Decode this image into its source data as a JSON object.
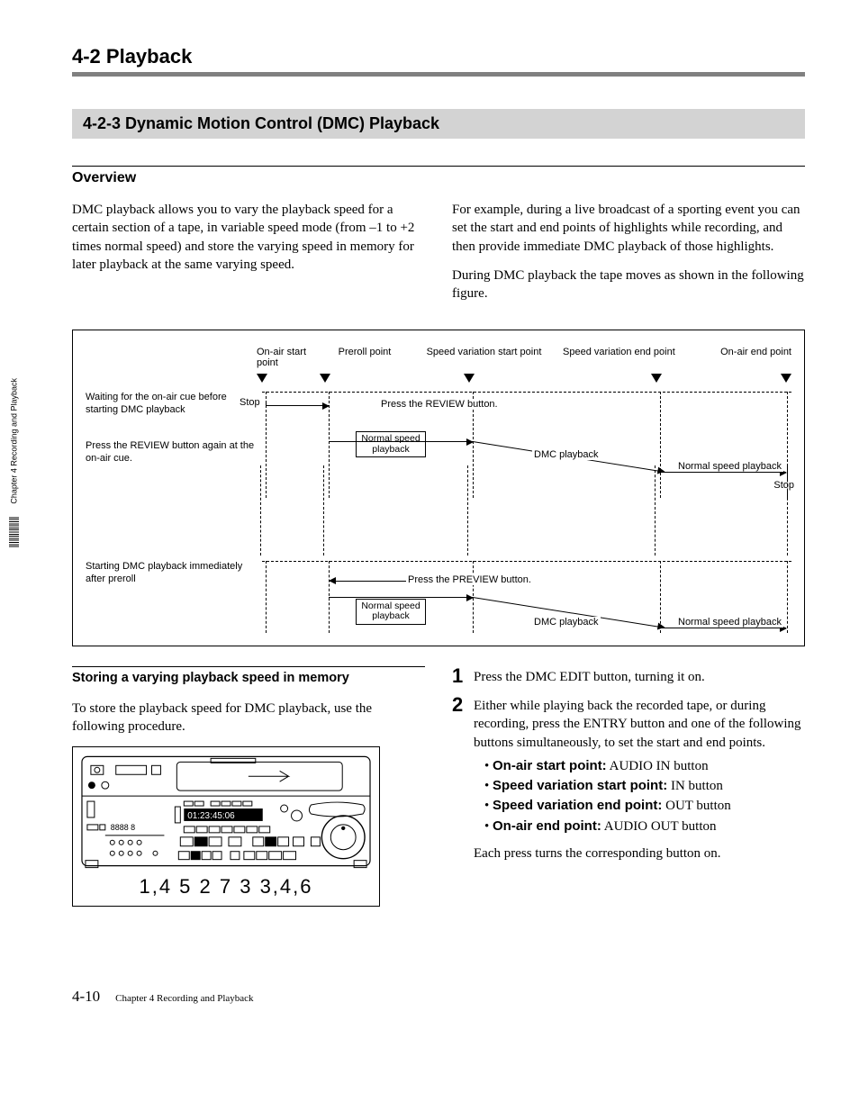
{
  "chapterTab": "Chapter 4   Recording and Playback",
  "header": {
    "chapterTitle": "4-2  Playback",
    "sectionTitle": "4-2-3  Dynamic Motion Control (DMC) Playback"
  },
  "overview": {
    "heading": "Overview",
    "paraLeft": "DMC playback allows you to vary the playback speed for a certain section of a tape, in variable speed mode (from –1 to +2 times normal speed) and store the varying speed in memory for later playback at the same varying speed.",
    "paraRight1": "For example, during a live broadcast of a sporting event you can set the start and end points of highlights while recording, and then provide immediate DMC playback of those highlights.",
    "paraRight2": "During DMC playback the tape moves as shown in the following figure."
  },
  "diagram": {
    "topLabels": {
      "onAirStart": "On-air start point",
      "preroll": "Preroll point",
      "speedStart": "Speed variation start point",
      "speedEnd": "Speed variation end point",
      "onAirEnd": "On-air end point"
    },
    "section1": {
      "leftText": "Waiting for the on-air cue before starting DMC playback",
      "stop": "Stop",
      "reviewBtn": "Press the REVIEW button.",
      "leftText2": "Press the REVIEW button again at the on-air cue.",
      "normal": "Normal speed playback",
      "dmc": "DMC playback",
      "normal2": "Normal speed playback",
      "stop2": "Stop"
    },
    "section2": {
      "leftText": "Starting DMC playback immediately after preroll",
      "previewBtn": "Press the PREVIEW button.",
      "normal": "Normal speed playback",
      "dmc": "DMC playback",
      "normal2": "Normal speed playback"
    }
  },
  "storing": {
    "heading": "Storing a varying playback speed in memory",
    "para": "To store the playback speed for DMC playback, use the following procedure.",
    "deviceTimecode": "01:23:45:06",
    "deviceNumbers": "1,4    5    2       7     3  3,4,6"
  },
  "steps": {
    "s1": "Press the DMC EDIT button, turning it on.",
    "s2_intro": "Either while playing back the recorded tape, or during recording, press the ENTRY button and one of the following buttons simultaneously, to set the start and end points.",
    "b1_label": "On-air start point:",
    "b1_rest": " AUDIO IN button",
    "b2_label": "Speed variation start point:",
    "b2_rest": " IN button",
    "b3_label": "Speed variation end point:",
    "b3_rest": " OUT button",
    "b4_label": "On-air end point:",
    "b4_rest": " AUDIO OUT button",
    "s2_after": "Each press turns the corresponding button on."
  },
  "footer": {
    "pageNum": "4-10",
    "chapter": "Chapter 4    Recording and Playback"
  }
}
